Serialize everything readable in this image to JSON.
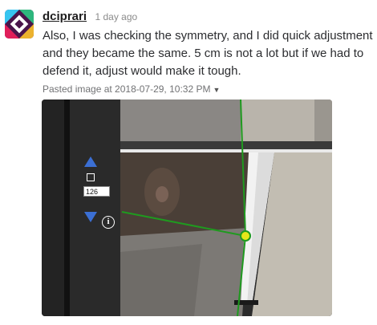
{
  "message": {
    "username": "dciprari",
    "timestamp": "1 day ago",
    "text": "Also, I was checking the symmetry, and I did quick adjustment and they became the same.  5 cm is not a lot but if we had to defend it, adjust would make it tough.",
    "attachment_label": "Pasted image at 2018-07-29, 10:32 PM"
  },
  "image": {
    "value_box": "126",
    "info_glyph": "i",
    "up_icon": "triangle-up-icon",
    "down_icon": "triangle-down-icon",
    "checkbox_icon": "square-icon",
    "info_icon": "info-circle-icon",
    "accent_blue": "#3b6fd4",
    "guide_green": "#1f9a1f",
    "marker_yellow": "#e6e61a"
  },
  "avatar": {
    "icon": "slack-logo-icon",
    "colors": [
      "#e01e5a",
      "#36c5f0",
      "#2eb67d",
      "#ecb22e",
      "#4a154b"
    ]
  }
}
